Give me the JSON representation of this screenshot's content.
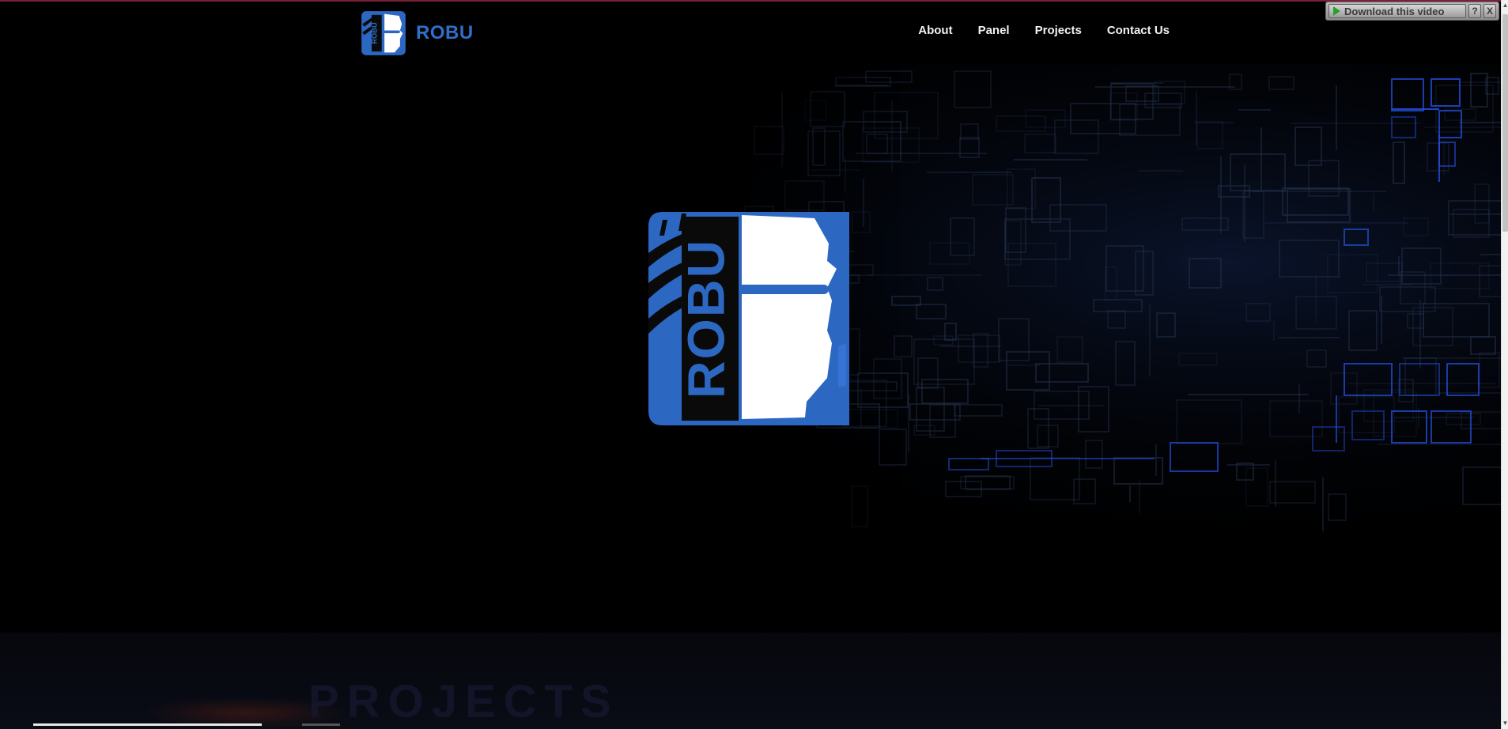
{
  "header": {
    "brand_name": "ROBU",
    "nav": [
      {
        "label": "About"
      },
      {
        "label": "Panel"
      },
      {
        "label": "Projects"
      },
      {
        "label": "Contact Us"
      }
    ]
  },
  "download_overlay": {
    "label": "Download this video",
    "help": "?",
    "close": "X"
  },
  "hero": {
    "logo_text": "ROBU"
  },
  "lower_section": {
    "faded_heading": "PROJECTS"
  },
  "video": {
    "progress_fraction": 0.74
  },
  "colors": {
    "brand_blue": "#2f6fc9",
    "logo_blue": "#2c68c2",
    "nav_text": "#f2f2f2",
    "background": "#000000",
    "circuit_glow": "#1e50ff"
  },
  "icons": {
    "download": "play-icon",
    "help": "help-icon",
    "close": "close-icon"
  }
}
